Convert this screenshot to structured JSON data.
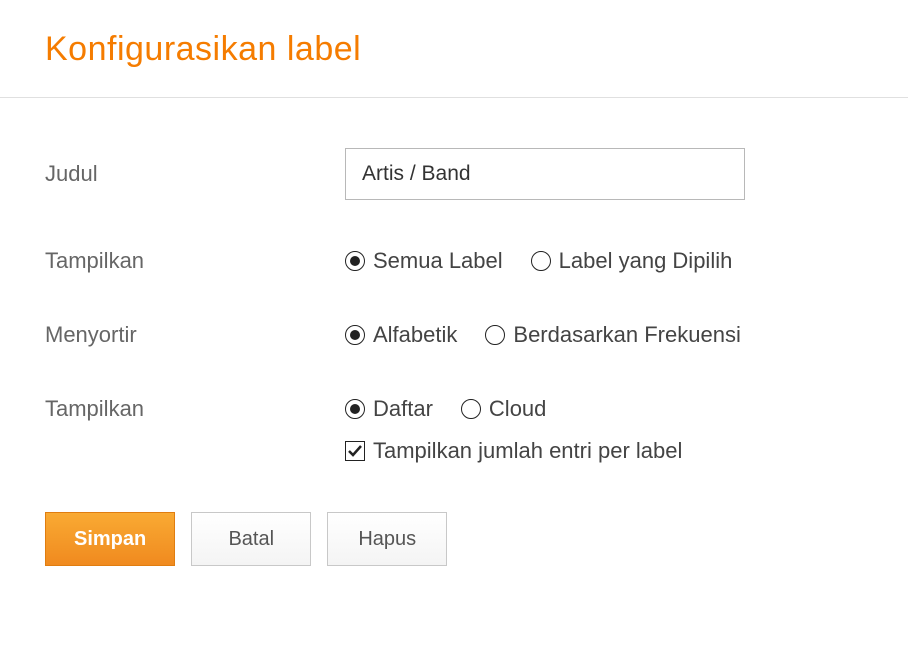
{
  "header": {
    "title": "Konfigurasikan label"
  },
  "form": {
    "judul": {
      "label": "Judul",
      "value": "Artis / Band"
    },
    "tampilkan_labels": {
      "label": "Tampilkan",
      "options": [
        {
          "label": "Semua Label",
          "selected": true
        },
        {
          "label": "Label yang Dipilih",
          "selected": false
        }
      ]
    },
    "menyortir": {
      "label": "Menyortir",
      "options": [
        {
          "label": "Alfabetik",
          "selected": true
        },
        {
          "label": "Berdasarkan Frekuensi",
          "selected": false
        }
      ]
    },
    "tampilkan_mode": {
      "label": "Tampilkan",
      "options": [
        {
          "label": "Daftar",
          "selected": true
        },
        {
          "label": "Cloud",
          "selected": false
        }
      ]
    },
    "show_count": {
      "label": "Tampilkan jumlah entri per label",
      "checked": true
    }
  },
  "buttons": {
    "save": "Simpan",
    "cancel": "Batal",
    "delete": "Hapus"
  }
}
